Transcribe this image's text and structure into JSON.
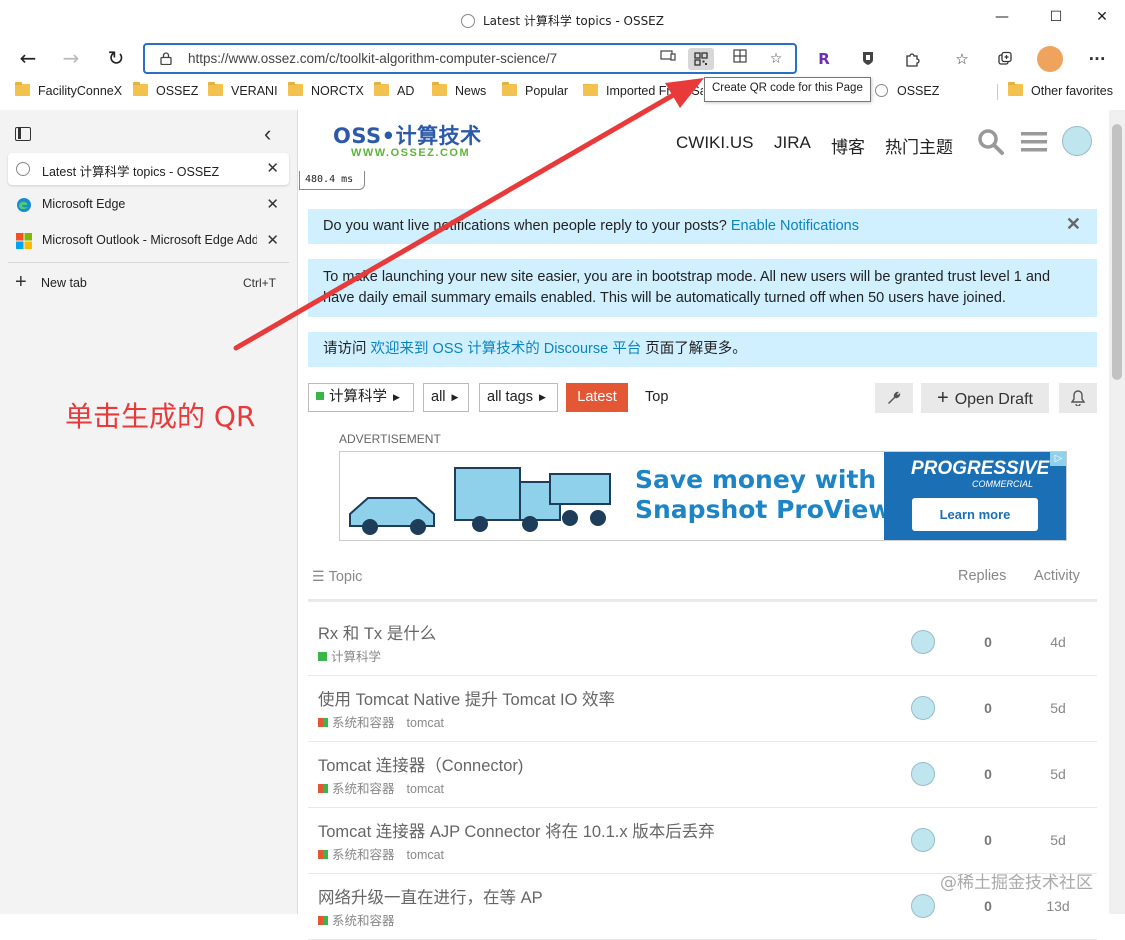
{
  "window": {
    "title": "Latest 计算科学 topics - OSSEZ",
    "minimize": "—",
    "maximize": "☐",
    "close": "✕"
  },
  "toolbar": {
    "back": "←",
    "forward": "→",
    "refresh": "↻",
    "url": "https://www.ossez.com/c/toolkit-algorithm-computer-science/7",
    "more": "···"
  },
  "favorites": [
    "FacilityConneX",
    "OSSEZ",
    "VERANI",
    "NORCTX",
    "AD",
    "News",
    "Popular",
    "Imported From Sa",
    "OSSEZ"
  ],
  "favorites_other": "Other favorites",
  "tooltip": "Create QR code for this Page",
  "sidebar": {
    "tabs": [
      {
        "label": "Latest 计算科学 topics - OSSEZ",
        "close": "✕"
      },
      {
        "label": "Microsoft Edge",
        "close": "✕"
      },
      {
        "label": "Microsoft Outlook - Microsoft Edge Add-ons",
        "close": "✕"
      }
    ],
    "new_tab": {
      "label": "New tab",
      "shortcut": "Ctrl+T",
      "plus": "+"
    },
    "collapse": "‹"
  },
  "annotation": "单击生成的 QR",
  "site": {
    "logo_main": "OSS•计算技术",
    "logo_sub": "WWW.OSSEZ.COM",
    "nav": [
      "CWIKI.US",
      "JIRA",
      "博客",
      "热门主题"
    ],
    "timer": "480.4 ms"
  },
  "banners": {
    "notify_text": "Do you want live notifications when people reply to your posts?",
    "notify_link": "Enable Notifications",
    "notify_close": "✕",
    "bootstrap": "To make launching your new site easier, you are in bootstrap mode. All new users will be granted trust level 1 and have daily email summary emails enabled. This will be automatically turned off when 50 users have joined.",
    "visit_pre": "请访问",
    "visit_link": "欢迎来到 OSS 计算技术的 Discourse 平台",
    "visit_post": "页面了解更多。"
  },
  "filters": {
    "category": "计算科学",
    "all": "all",
    "tags": "all tags",
    "latest": "Latest",
    "top": "Top",
    "open_draft": "Open Draft",
    "wrench": "🔧",
    "bell": "🔔",
    "plus": "+"
  },
  "ad": {
    "label": "ADVERTISEMENT",
    "line1": "Save money with",
    "line2": "Snapshot ProView",
    "brand": "PROGRESSIVE",
    "brand_sub": "COMMERCIAL",
    "cta": "Learn more",
    "badge": "▷"
  },
  "table": {
    "col_topic": "Topic",
    "col_replies": "Replies",
    "col_activity": "Activity",
    "rows": [
      {
        "title": "Rx 和 Tx 是什么",
        "category": "计算科学",
        "tag": "",
        "replies": "0",
        "activity": "4d",
        "cat_style": "green"
      },
      {
        "title": "使用 Tomcat Native 提升 Tomcat IO 效率",
        "category": "系统和容器",
        "tag": "tomcat",
        "replies": "0",
        "activity": "5d",
        "cat_style": "split"
      },
      {
        "title": "Tomcat 连接器（Connector)",
        "category": "系统和容器",
        "tag": "tomcat",
        "replies": "0",
        "activity": "5d",
        "cat_style": "split"
      },
      {
        "title": "Tomcat 连接器 AJP Connector 将在 10.1.x 版本后丢弃",
        "category": "系统和容器",
        "tag": "tomcat",
        "replies": "0",
        "activity": "5d",
        "cat_style": "split"
      },
      {
        "title": "网络升级一直在进行，在等 AP",
        "category": "系统和容器",
        "tag": "",
        "replies": "0",
        "activity": "13d",
        "cat_style": "split"
      }
    ]
  },
  "watermark": "@稀土掘金技术社区",
  "colors": {
    "accent": "#e45735",
    "link": "#0a84c2",
    "banner": "#d1f0ff",
    "annotation": "#e83a3a",
    "addr_border": "#2a6ec7"
  }
}
